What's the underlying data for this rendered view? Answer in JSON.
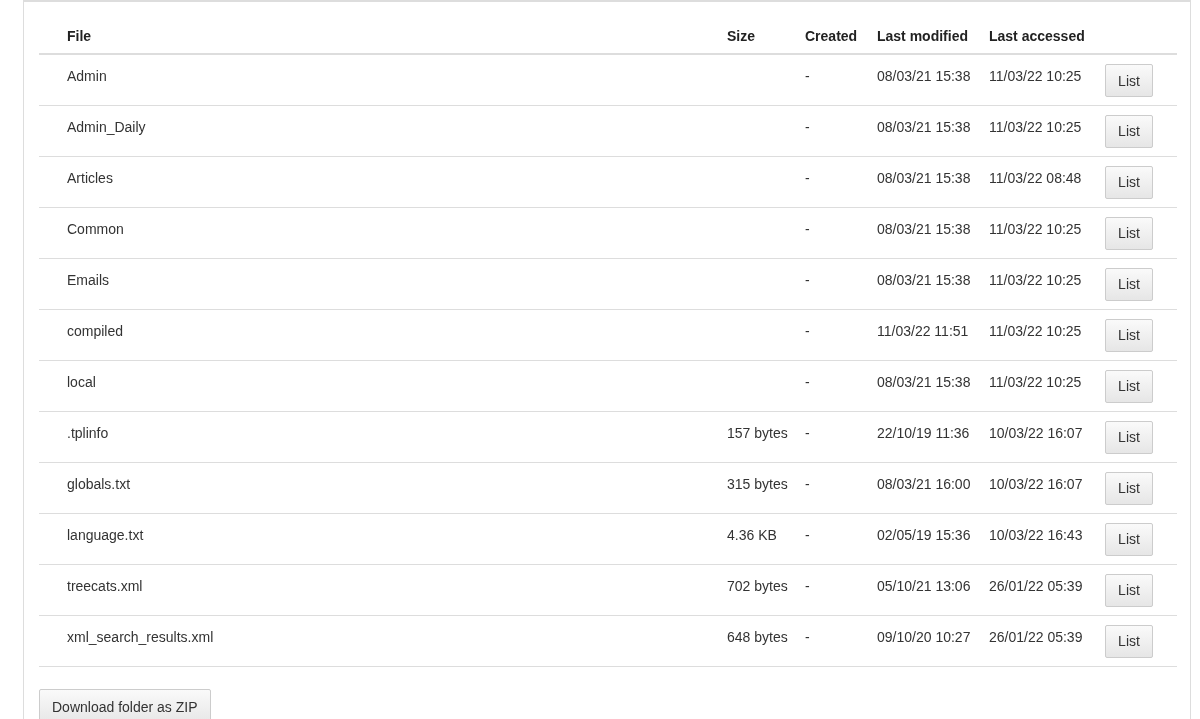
{
  "table": {
    "columns": [
      "File",
      "Size",
      "Created",
      "Last modified",
      "Last accessed"
    ],
    "rows": [
      {
        "file": "Admin",
        "size": "",
        "created": "-",
        "modified": "08/03/21 15:38",
        "accessed": "11/03/22 10:25",
        "action": "List"
      },
      {
        "file": "Admin_Daily",
        "size": "",
        "created": "-",
        "modified": "08/03/21 15:38",
        "accessed": "11/03/22 10:25",
        "action": "List"
      },
      {
        "file": "Articles",
        "size": "",
        "created": "-",
        "modified": "08/03/21 15:38",
        "accessed": "11/03/22 08:48",
        "action": "List"
      },
      {
        "file": "Common",
        "size": "",
        "created": "-",
        "modified": "08/03/21 15:38",
        "accessed": "11/03/22 10:25",
        "action": "List"
      },
      {
        "file": "Emails",
        "size": "",
        "created": "-",
        "modified": "08/03/21 15:38",
        "accessed": "11/03/22 10:25",
        "action": "List"
      },
      {
        "file": "compiled",
        "size": "",
        "created": "-",
        "modified": "11/03/22 11:51",
        "accessed": "11/03/22 10:25",
        "action": "List"
      },
      {
        "file": "local",
        "size": "",
        "created": "-",
        "modified": "08/03/21 15:38",
        "accessed": "11/03/22 10:25",
        "action": "List"
      },
      {
        "file": ".tplinfo",
        "size": "157 bytes",
        "created": "-",
        "modified": "22/10/19 11:36",
        "accessed": "10/03/22 16:07",
        "action": "List"
      },
      {
        "file": "globals.txt",
        "size": "315 bytes",
        "created": "-",
        "modified": "08/03/21 16:00",
        "accessed": "10/03/22 16:07",
        "action": "List"
      },
      {
        "file": "language.txt",
        "size": "4.36 KB",
        "created": "-",
        "modified": "02/05/19 15:36",
        "accessed": "10/03/22 16:43",
        "action": "List"
      },
      {
        "file": "treecats.xml",
        "size": "702 bytes",
        "created": "-",
        "modified": "05/10/21 13:06",
        "accessed": "26/01/22 05:39",
        "action": "List"
      },
      {
        "file": "xml_search_results.xml",
        "size": "648 bytes",
        "created": "-",
        "modified": "09/10/20 10:27",
        "accessed": "26/01/22 05:39",
        "action": "List"
      }
    ]
  },
  "download_button": "Download folder as ZIP"
}
